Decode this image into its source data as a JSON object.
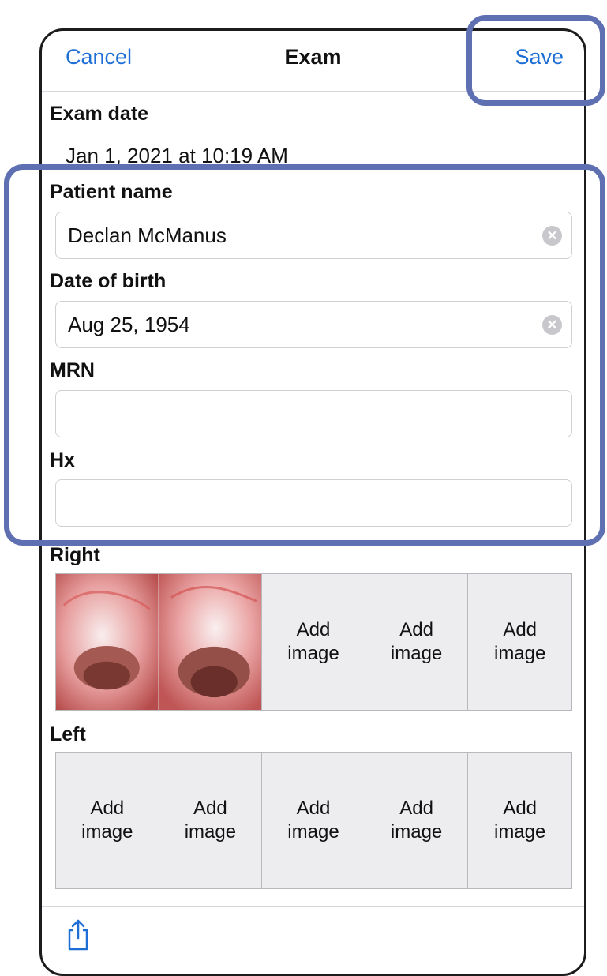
{
  "header": {
    "cancel_label": "Cancel",
    "title": "Exam",
    "save_label": "Save"
  },
  "exam_date": {
    "label": "Exam date",
    "value": "Jan 1, 2021 at 10:19 AM"
  },
  "patient_name": {
    "label": "Patient name",
    "value": "Declan McManus"
  },
  "date_of_birth": {
    "label": "Date of birth",
    "value": "Aug 25, 1954"
  },
  "mrn": {
    "label": "MRN",
    "value": ""
  },
  "hx": {
    "label": "Hx",
    "value": ""
  },
  "right": {
    "label": "Right",
    "add_image_label_line1": "Add",
    "add_image_label_line2": "image"
  },
  "left": {
    "label": "Left",
    "add_image_label_line1": "Add",
    "add_image_label_line2": "image"
  },
  "icons": {
    "clear": "clear-icon",
    "share": "share-icon"
  },
  "colors": {
    "accent": "#1d6fd6",
    "highlight": "#5f70b2"
  }
}
